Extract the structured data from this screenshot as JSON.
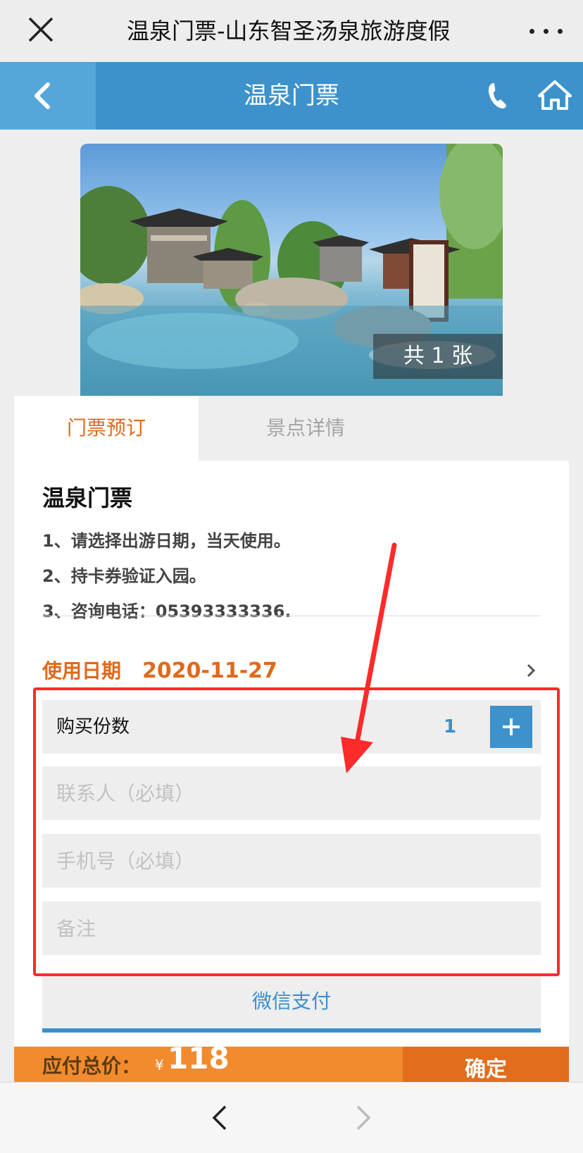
{
  "wechat_bar": {
    "title": "温泉门票-山东智圣汤泉旅游度假",
    "close_icon": "close-icon",
    "more_icon": "more-icon"
  },
  "nav": {
    "title": "温泉门票",
    "back_icon": "chevron-left-icon",
    "phone_icon": "phone-icon",
    "home_icon": "home-icon",
    "color": "#3d92cb"
  },
  "banner": {
    "count_text": "共 1 张"
  },
  "tabs": [
    {
      "label": "门票预订",
      "active": true
    },
    {
      "label": "景点详情",
      "active": false
    }
  ],
  "product": {
    "title": "温泉门票",
    "notes": [
      "1、请选择出游日期，当天使用。",
      "2、持卡券验证入园。",
      "3、咨询电话：05393333336."
    ]
  },
  "date": {
    "label": "使用日期",
    "value": "2020-11-27"
  },
  "quantity": {
    "label": "购买份数",
    "value": "1"
  },
  "form": {
    "contact_placeholder": "联系人（必填）",
    "phone_placeholder": "手机号（必填）",
    "remark_placeholder": "备注"
  },
  "payment": {
    "method_label": "微信支付"
  },
  "checkout": {
    "total_label": "应付总价：",
    "currency": "¥",
    "total_value": "118",
    "confirm_label": "确定",
    "accent_color": "#f28b2e"
  },
  "browser": {
    "back_icon": "chevron-left-icon",
    "forward_icon": "chevron-right-icon"
  },
  "colors": {
    "orange_text": "#e0691b",
    "blue_accent": "#3a90cc",
    "annotation_red": "#ff2a2a"
  }
}
